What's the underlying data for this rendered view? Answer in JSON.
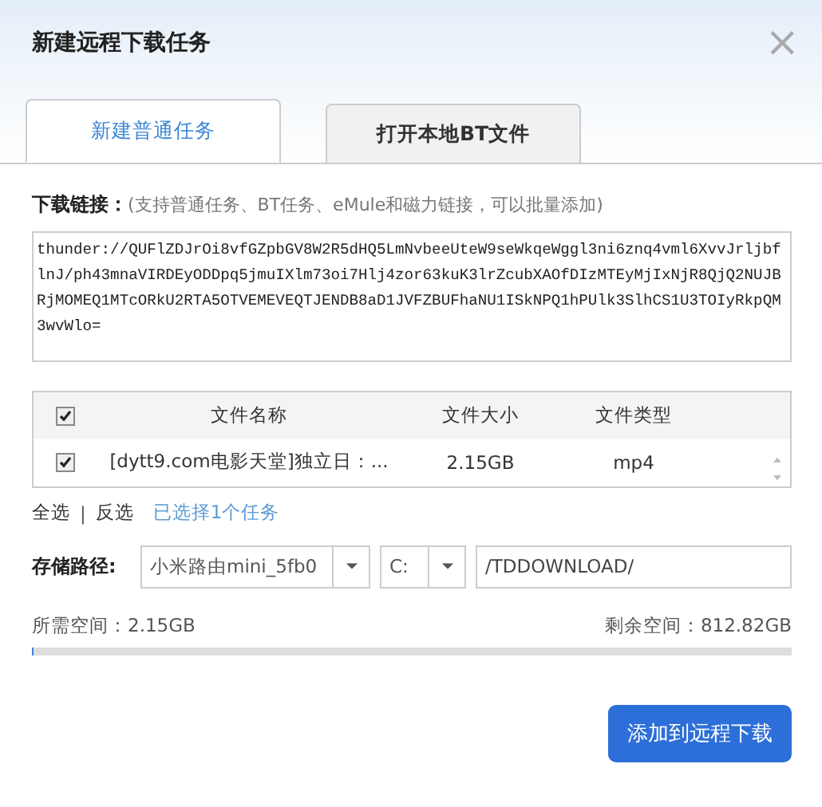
{
  "window": {
    "title": "新建远程下载任务",
    "close": "×"
  },
  "tabs": [
    {
      "label": "新建普通任务",
      "selected": true
    },
    {
      "label": "打开本地BT文件",
      "selected": false
    }
  ],
  "link_field": {
    "label": "下载链接：",
    "hint": "(支持普通任务、BT任务、eMule和磁力链接，可以批量添加)",
    "value": "thunder://QUFlZDJrOi8vfGZpbGV8W2R5dHQ5LmNvbeeUteW9seWkqeWggl3ni6znq4vml6XvvJrljbflnJ/ph43mnaVIRDEyODDpq5jmuIXlm73oi7Hlj4zor63kuK3lrZcubXAOfDIzMTEyMjIxNjR8QjQ2NUJBRjMOMEQ1MTcORkU2RTA5OTVEMEVEQTJENDB8aD1JVFZBUFhaNU1ISkNPQ1hPUlk3SlhCS1U3TOIyRkpQM3wvWlo="
  },
  "table": {
    "header_checked": true,
    "columns": [
      "文件名称",
      "文件大小",
      "文件类型"
    ],
    "rows": [
      {
        "checked": true,
        "cells": [
          "[dytt9.com电影天堂]独立日：...",
          "2.15GB",
          "mp4"
        ]
      }
    ]
  },
  "selection": {
    "select_all": "全选",
    "separator": "|",
    "invert": "反选",
    "status": "已选择1个任务"
  },
  "storage": {
    "label": "存储路径:",
    "device": "小米路由mini_5fb0",
    "drive": "C:",
    "path": "/TDDOWNLOAD/"
  },
  "space": {
    "required": "所需空间：2.15GB",
    "remaining": "剩余空间：812.82GB",
    "level": 0.003
  },
  "buttons": [
    "添加到远程下载"
  ]
}
